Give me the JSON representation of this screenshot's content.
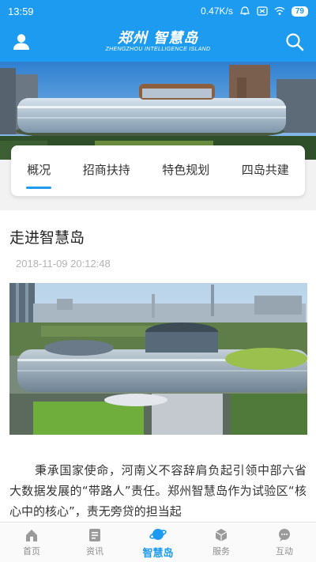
{
  "status_bar": {
    "time": "13:59",
    "net_speed": "0.47K/s",
    "battery": "79"
  },
  "header": {
    "title": "郑州 智慧岛",
    "subtitle": "ZHENGZHOU INTELLIGENCE ISLAND",
    "user_icon": "user-icon",
    "search_icon": "search-icon"
  },
  "tabs": [
    {
      "label": "概况",
      "active": true
    },
    {
      "label": "招商扶持",
      "active": false
    },
    {
      "label": "特色规划",
      "active": false
    },
    {
      "label": "四岛共建",
      "active": false
    }
  ],
  "article": {
    "title": "走进智慧岛",
    "time": "2018-11-09 20:12:48",
    "body": "秉承国家使命，河南义不容辞肩负起引领中部六省大数据发展的“带路人”责任。郑州智慧岛作为试验区“核心中的核心”，责无旁贷的担当起"
  },
  "tabbar": [
    {
      "label": "首页",
      "icon": "home-icon",
      "active": false
    },
    {
      "label": "资讯",
      "icon": "news-icon",
      "active": false
    },
    {
      "label": "智慧岛",
      "icon": "planet-icon",
      "active": true
    },
    {
      "label": "服务",
      "icon": "box-icon",
      "active": false
    },
    {
      "label": "互动",
      "icon": "chat-icon",
      "active": false
    }
  ],
  "colors": {
    "primary": "#1d9bf0",
    "tab_text": "#333333",
    "muted": "#b3b3b3"
  }
}
